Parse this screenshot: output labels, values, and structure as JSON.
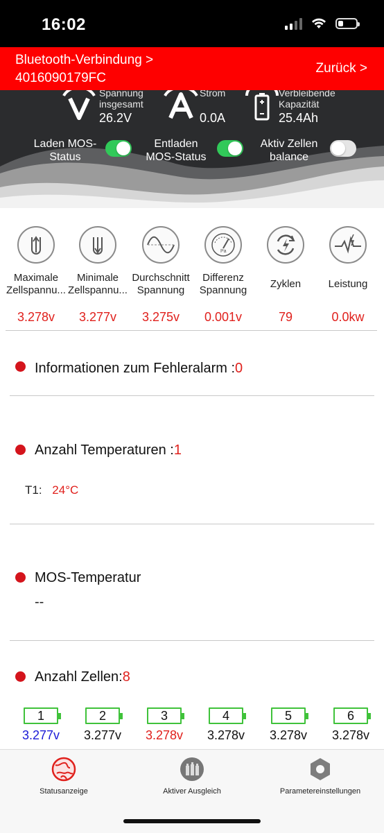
{
  "status_bar": {
    "time": "16:02"
  },
  "header": {
    "bluetooth_line1": "Bluetooth-Verbindung >",
    "bluetooth_line2": "4016090179FC",
    "back": "Zurück >"
  },
  "metrics": [
    {
      "icon": "voltage-icon",
      "glyph": "V",
      "label_line1": "Spannung",
      "label_line2": "insgesamt",
      "value": "26.2V"
    },
    {
      "icon": "current-icon",
      "glyph": "A",
      "label_line1": "Strom",
      "label_line2": "",
      "value": "0.0A"
    },
    {
      "icon": "battery-capacity-icon",
      "glyph": "",
      "label_line1": "Verbleibende",
      "label_line2": "Kapazität",
      "value": "25.4Ah"
    }
  ],
  "toggles": [
    {
      "label_line1": "Laden MOS-",
      "label_line2": "Status",
      "on": true
    },
    {
      "label_line1": "Entladen",
      "label_line2": "MOS-Status",
      "on": true
    },
    {
      "label_line1": "Aktiv Zellen",
      "label_line2": "balance",
      "on": false
    }
  ],
  "stats": [
    {
      "icon": "max-cell-voltage-icon",
      "name_line1": "Maximale",
      "name_line2": "Zellspannu...",
      "value": "3.278v"
    },
    {
      "icon": "min-cell-voltage-icon",
      "name_line1": "Minimale",
      "name_line2": "Zellspannu...",
      "value": "3.277v"
    },
    {
      "icon": "average-voltage-icon",
      "name_line1": "Durchschnitt",
      "name_line2": "Spannung",
      "value": "3.275v"
    },
    {
      "icon": "voltage-difference-icon",
      "name_line1": "Differenz",
      "name_line2": "Spannung",
      "value": "0.001v"
    },
    {
      "icon": "cycles-icon",
      "name_line1": "Zyklen",
      "name_line2": "",
      "value": "79"
    },
    {
      "icon": "power-icon",
      "name_line1": "Leistung",
      "name_line2": "",
      "value": "0.0kw"
    }
  ],
  "alarm": {
    "label": "Informationen zum Fehleralarm :",
    "value": "0"
  },
  "temperatures": {
    "label": "Anzahl Temperaturen :",
    "count": "1",
    "items": [
      {
        "name": "T1:",
        "value": "24°C"
      }
    ]
  },
  "mos_temperature": {
    "label": "MOS-Temperatur",
    "value": "--"
  },
  "cells": {
    "label": "Anzahl Zellen:",
    "count": "8",
    "items": [
      {
        "index": "1",
        "voltage": "3.277v",
        "color": "#1a1ad6"
      },
      {
        "index": "2",
        "voltage": "3.277v",
        "color": "#111111"
      },
      {
        "index": "3",
        "voltage": "3.278v",
        "color": "#e0201c"
      },
      {
        "index": "4",
        "voltage": "3.278v",
        "color": "#111111"
      },
      {
        "index": "5",
        "voltage": "3.278v",
        "color": "#111111"
      },
      {
        "index": "6",
        "voltage": "3.278v",
        "color": "#111111"
      }
    ]
  },
  "tabs": [
    {
      "label": "Statusanzeige",
      "icon": "status-globe-icon",
      "active": true
    },
    {
      "label": "Aktiver Ausgleich",
      "icon": "balance-icon",
      "active": false
    },
    {
      "label": "Parametereinstellungen",
      "icon": "settings-hexagon-icon",
      "active": false
    }
  ],
  "colors": {
    "accent_red": "#fe0000",
    "dark_panel": "#2b2c2e",
    "switch_on": "#31c959",
    "cell_green": "#3fc23a"
  }
}
